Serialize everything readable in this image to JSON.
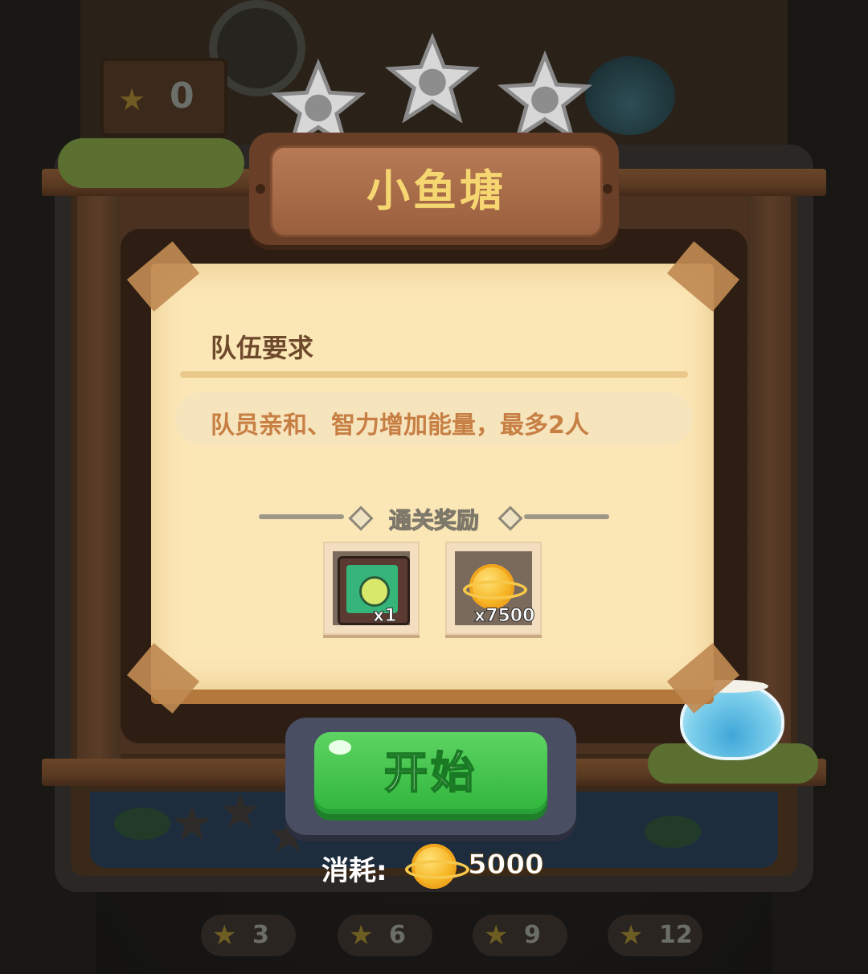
{
  "background": {
    "star_counter_value": "0",
    "bottom_counters": [
      "3",
      "6",
      "9",
      "12"
    ]
  },
  "level": {
    "title": "小鱼塘",
    "stars_total": 3,
    "stars_earned": 0
  },
  "panel": {
    "requirement_title": "队伍要求",
    "requirement_text": "队员亲和、智力增加能量，最多2人",
    "reward_header": "通关奖励",
    "rewards": [
      {
        "icon": "skill-book-icon",
        "qty": "x1"
      },
      {
        "icon": "gold-planet-coin-icon",
        "qty": "x7500"
      }
    ]
  },
  "actions": {
    "start_label": "开始",
    "cost_label": "消耗:",
    "cost_icon": "gold-planet-coin-icon",
    "cost_amount": "5000"
  },
  "colors": {
    "title": "#f6d671",
    "start_button": "#3cc247",
    "requirement_text": "#c77f44",
    "parchment": "#fbe6b5"
  }
}
